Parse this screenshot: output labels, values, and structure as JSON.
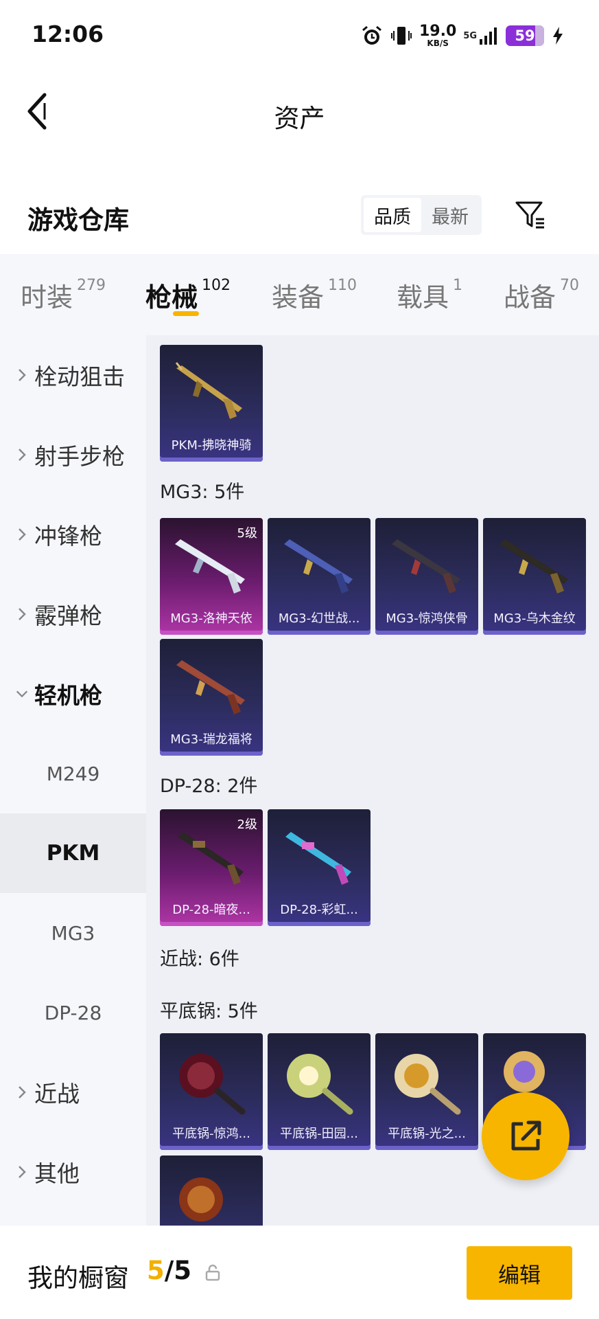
{
  "status": {
    "time": "12:06",
    "net_speed": "19.0",
    "net_unit": "KB/S",
    "network": "5G",
    "battery": "59"
  },
  "header": {
    "title": "资产"
  },
  "section": {
    "title": "游戏仓库",
    "sort_options": [
      "品质",
      "最新"
    ],
    "active_sort": "品质"
  },
  "tabs": [
    {
      "label": "时装",
      "count": "279"
    },
    {
      "label": "枪械",
      "count": "102",
      "active": true
    },
    {
      "label": "装备",
      "count": "110"
    },
    {
      "label": "载具",
      "count": "1"
    },
    {
      "label": "战备",
      "count": "70"
    }
  ],
  "sidebar": {
    "items": [
      "栓动狙击",
      "射手步枪",
      "冲锋枪",
      "霰弹枪",
      "轻机枪"
    ],
    "subitems": [
      "M249",
      "PKM",
      "MG3",
      "DP-28"
    ],
    "active_sub": "PKM",
    "more": [
      "近战",
      "其他"
    ]
  },
  "groups": {
    "mg3": "MG3: 5件",
    "dp28": "DP-28: 2件",
    "melee": "近战: 6件",
    "pan": "平底锅: 5件"
  },
  "cards": {
    "pkm1": {
      "name": "PKM-拂晓神骑"
    },
    "mg3_1": {
      "name": "MG3-洛神天依",
      "level": "5级"
    },
    "mg3_2": {
      "name": "MG3-幻世战..."
    },
    "mg3_3": {
      "name": "MG3-惊鸿侠骨"
    },
    "mg3_4": {
      "name": "MG3-乌木金纹"
    },
    "mg3_5": {
      "name": "MG3-瑞龙福将"
    },
    "dp_1": {
      "name": "DP-28-暗夜...",
      "level": "2级"
    },
    "dp_2": {
      "name": "DP-28-彩虹..."
    },
    "pan_1": {
      "name": "平底锅-惊鸿..."
    },
    "pan_2": {
      "name": "平底锅-田园..."
    },
    "pan_3": {
      "name": "平底锅-光之..."
    },
    "pan_4": {
      "name": "..."
    }
  },
  "bottom": {
    "label": "我的橱窗",
    "current": "5",
    "total": "/5",
    "edit": "编辑"
  },
  "colors": {
    "accent": "#f7b500",
    "card_blue": "#2c2c5c",
    "card_purple": "#b036a7"
  }
}
